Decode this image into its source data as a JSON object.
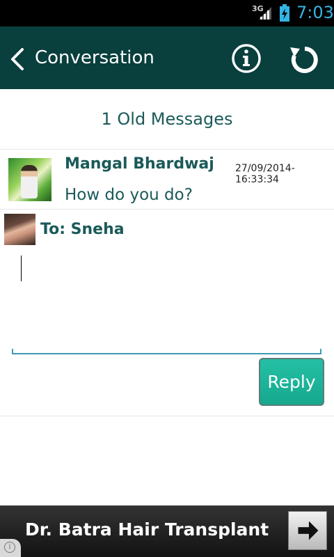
{
  "status_bar": {
    "network": "3G",
    "time": "7:03"
  },
  "header": {
    "title": "Conversation"
  },
  "old_messages": {
    "label": "1 Old Messages"
  },
  "message": {
    "sender": "Mangal Bhardwaj",
    "timestamp": "27/09/2014-16:33:34",
    "text": "How do you do?"
  },
  "compose": {
    "to_label": "To: Sneha",
    "value": "",
    "reply_label": "Reply"
  },
  "ad": {
    "text": "Dr. Batra Hair Transplant",
    "info_glyph": "i"
  },
  "colors": {
    "header_bg": "#093f3d",
    "accent_text": "#1a5a59",
    "reply_button": "#1bb39a",
    "status_clock": "#33b5e5"
  }
}
